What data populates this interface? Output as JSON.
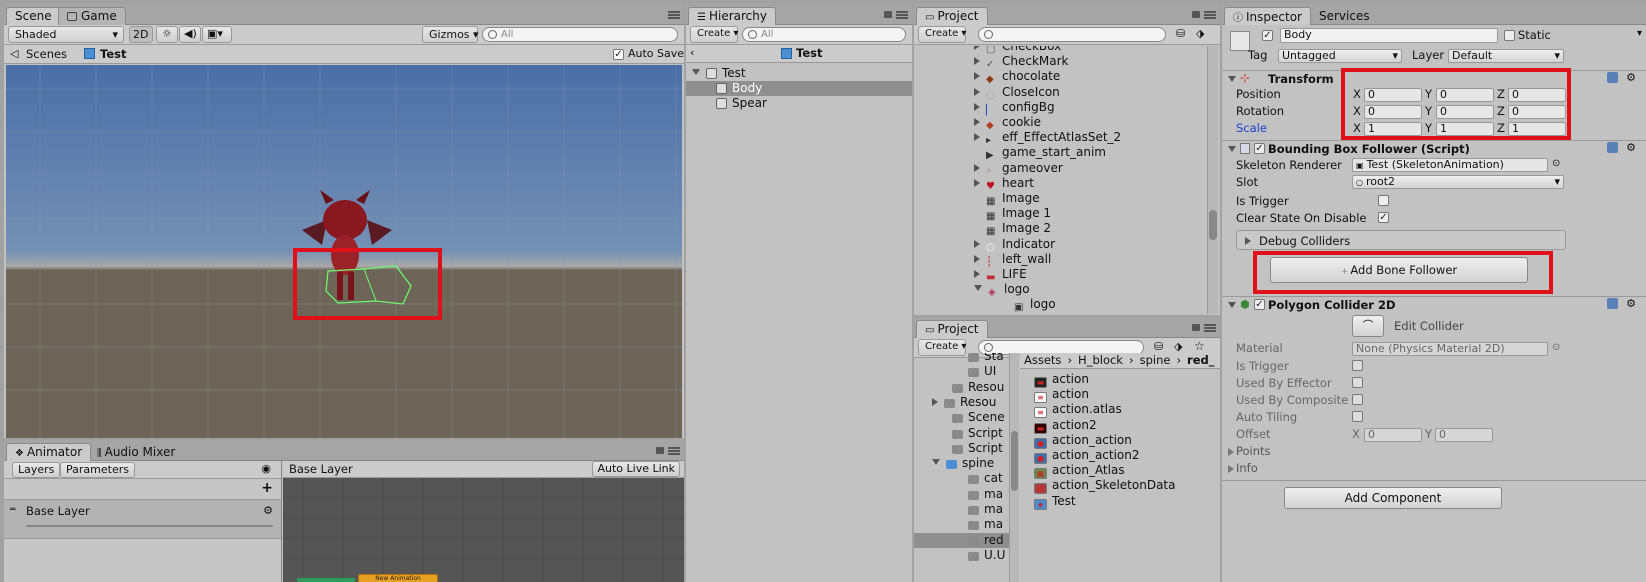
{
  "scene": {
    "tabs": [
      "Scene",
      "Game"
    ],
    "shading": "Shaded",
    "mode_2d": "2D",
    "gizmos": "Gizmos",
    "search_placeholder": "All",
    "breadcrumb_root": "Scenes",
    "breadcrumb_current": "Test",
    "auto_save": "Auto Save"
  },
  "animator": {
    "tabs": [
      "Animator",
      "Audio Mixer"
    ],
    "sub_tabs": [
      "Layers",
      "Parameters"
    ],
    "layer_name": "Base Layer",
    "graph_crumb": "Base Layer",
    "auto_live_link": "Auto Live Link",
    "state_node": "New Animation",
    "add": "+"
  },
  "hierarchy": {
    "tab": "Hierarchy",
    "create": "Create",
    "search_placeholder": "All",
    "scene_title": "Test",
    "items": [
      {
        "label": "Test"
      },
      {
        "label": "Body"
      },
      {
        "label": "Spear"
      }
    ]
  },
  "project_top": {
    "tab": "Project",
    "create": "Create",
    "items": [
      "CheckBox",
      "CheckMark",
      "chocolate",
      "CloseIcon",
      "configBg",
      "cookie",
      "eff_EffectAtlasSet_2",
      "game_start_anim",
      "gameover",
      "heart",
      "Image",
      "Image 1",
      "Image 2",
      "Indicator",
      "left_wall",
      "LIFE",
      "logo",
      "logo"
    ]
  },
  "project_bottom": {
    "tab": "Project",
    "create": "Create",
    "folders": [
      "Sta",
      "UI",
      "Resou",
      "Resou",
      "Scene",
      "Script",
      "Script",
      "spine",
      "cat",
      "ma",
      "ma",
      "ma",
      "red",
      "U.U"
    ],
    "breadcrumb": [
      "Assets",
      "H_block",
      "spine",
      "red_"
    ],
    "assets": [
      "action",
      "action",
      "action.atlas",
      "action2",
      "action_action",
      "action_action2",
      "action_Atlas",
      "action_SkeletonData",
      "Test"
    ]
  },
  "inspector": {
    "tabs": [
      "Inspector",
      "Services"
    ],
    "object_name": "Body",
    "static_label": "Static",
    "tag_label": "Tag",
    "tag_value": "Untagged",
    "layer_label": "Layer",
    "layer_value": "Default",
    "transform": {
      "title": "Transform",
      "rows": [
        {
          "label": "Position",
          "x": "0",
          "y": "0",
          "z": "0"
        },
        {
          "label": "Rotation",
          "x": "0",
          "y": "0",
          "z": "0"
        },
        {
          "label": "Scale",
          "x": "1",
          "y": "1",
          "z": "1"
        }
      ],
      "axes": [
        "X",
        "Y",
        "Z"
      ]
    },
    "bbf": {
      "title": "Bounding Box Follower (Script)",
      "skeleton_renderer_label": "Skeleton Renderer",
      "skeleton_renderer_value": "Test (SkeletonAnimation)",
      "slot_label": "Slot",
      "slot_value": "root2",
      "is_trigger_label": "Is Trigger",
      "clear_state_label": "Clear State On Disable",
      "debug_colliders": "Debug Colliders",
      "add_bone_follower": "Add Bone Follower"
    },
    "poly": {
      "title": "Polygon Collider 2D",
      "edit_collider": "Edit Collider",
      "material_label": "Material",
      "material_value": "None (Physics Material 2D)",
      "is_trigger": "Is Trigger",
      "used_by_effector": "Used By Effector",
      "used_by_composite": "Used By Composite",
      "auto_tiling": "Auto Tiling",
      "offset_label": "Offset",
      "offset_x": "0",
      "offset_y": "0",
      "points": "Points",
      "info": "Info"
    },
    "add_component": "Add Component"
  },
  "colors": {
    "highlight_red": "#e0101a",
    "selection": "#8f8f8f",
    "scale_label": "#1a3fcf"
  }
}
